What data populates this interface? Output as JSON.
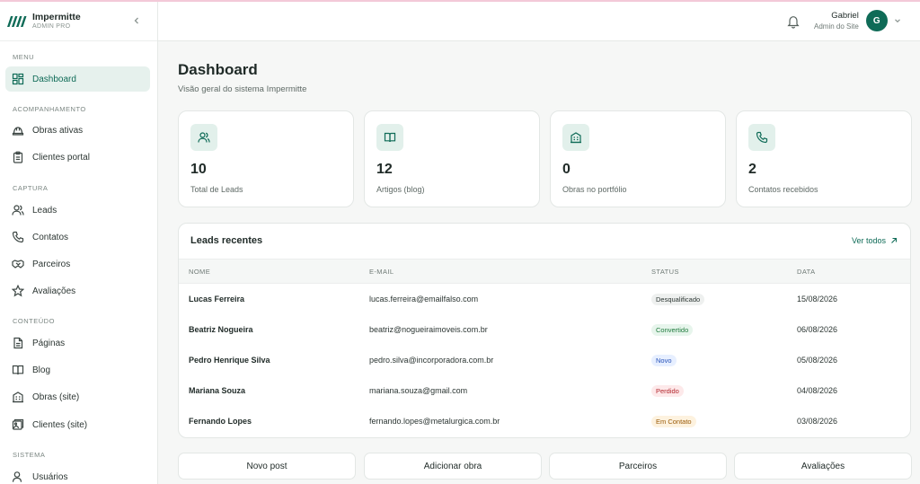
{
  "app": {
    "name": "Impermitte",
    "subtitle": "ADMIN PRO"
  },
  "sidebar": {
    "sections": [
      {
        "title": "MENU"
      },
      {
        "title": "ACOMPANHAMENTO"
      },
      {
        "title": "CAPTURA"
      },
      {
        "title": "CONTEÚDO"
      },
      {
        "title": "SISTEMA"
      }
    ],
    "items": [
      {
        "label": "Dashboard",
        "icon": "dashboard-icon",
        "active": true
      },
      {
        "label": "Obras ativas",
        "icon": "hard-hat-icon"
      },
      {
        "label": "Clientes portal",
        "icon": "clipboard-icon"
      },
      {
        "label": "Leads",
        "icon": "users-icon"
      },
      {
        "label": "Contatos",
        "icon": "phone-icon"
      },
      {
        "label": "Parceiros",
        "icon": "handshake-icon"
      },
      {
        "label": "Avaliações",
        "icon": "star-icon"
      },
      {
        "label": "Páginas",
        "icon": "file-icon"
      },
      {
        "label": "Blog",
        "icon": "book-icon"
      },
      {
        "label": "Obras (site)",
        "icon": "building-icon"
      },
      {
        "label": "Clientes (site)",
        "icon": "image-icon"
      },
      {
        "label": "Usuários",
        "icon": "user-icon"
      }
    ]
  },
  "header": {
    "user_name": "Gabriel",
    "user_role": "Admin do Site",
    "avatar_initial": "G"
  },
  "page": {
    "title": "Dashboard",
    "subtitle": "Visão geral do sistema Impermitte"
  },
  "stats": [
    {
      "value": "10",
      "label": "Total de Leads",
      "icon": "users-icon"
    },
    {
      "value": "12",
      "label": "Artigos (blog)",
      "icon": "book-icon"
    },
    {
      "value": "0",
      "label": "Obras no portfólio",
      "icon": "building-icon"
    },
    {
      "value": "2",
      "label": "Contatos recebidos",
      "icon": "phone-icon"
    }
  ],
  "leads": {
    "title": "Leads recentes",
    "see_all": "Ver todos",
    "columns": [
      "NOME",
      "E-MAIL",
      "STATUS",
      "DATA"
    ],
    "rows": [
      {
        "name": "Lucas Ferreira",
        "email": "lucas.ferreira@emailfalso.com",
        "status": "Desqualificado",
        "status_color": "#eef0ef",
        "date": "15/08/2026"
      },
      {
        "name": "Beatriz Nogueira",
        "email": "beatriz@nogueiraimoveis.com.br",
        "status": "Convertido",
        "status_color": "#e7f5ec",
        "date": "06/08/2026"
      },
      {
        "name": "Pedro Henrique Silva",
        "email": "pedro.silva@incorporadora.com.br",
        "status": "Novo",
        "status_color": "#e7efff",
        "date": "05/08/2026"
      },
      {
        "name": "Mariana Souza",
        "email": "mariana.souza@gmail.com",
        "status": "Perdido",
        "status_color": "#fde9ea",
        "date": "04/08/2026"
      },
      {
        "name": "Fernando Lopes",
        "email": "fernando.lopes@metalurgica.com.br",
        "status": "Em Contato",
        "status_color": "#fdf2df",
        "date": "03/08/2026"
      }
    ]
  },
  "quick_actions": [
    "Novo post",
    "Adicionar obra",
    "Parceiros",
    "Avaliações"
  ],
  "colors": {
    "accent": "#0f6b57",
    "accent_light": "#e6f1ed"
  }
}
